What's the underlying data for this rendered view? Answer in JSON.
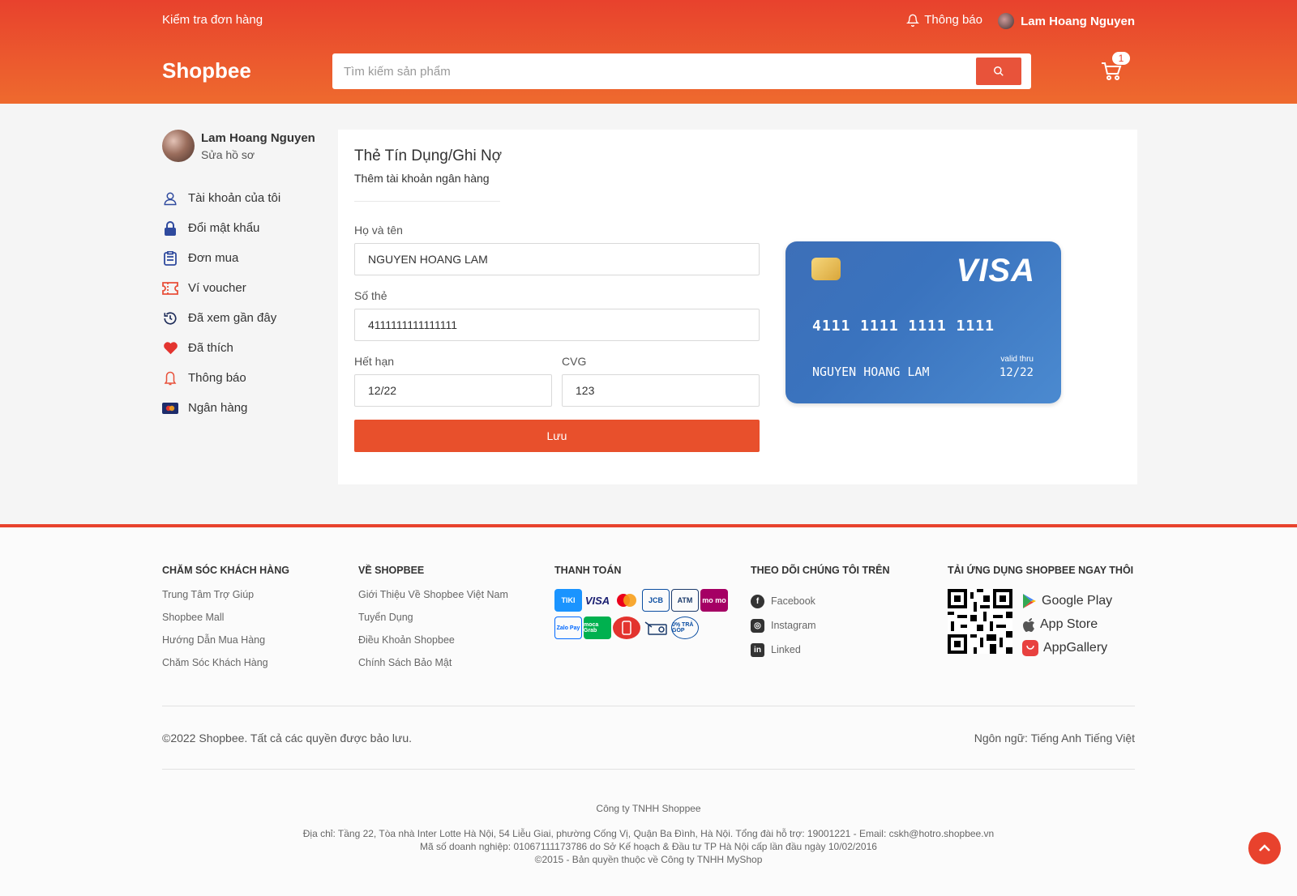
{
  "header": {
    "check_order": "Kiểm tra đơn hàng",
    "notifications": "Thông báo",
    "user_name": "Lam Hoang Nguyen",
    "logo": "Shopbee",
    "search_placeholder": "Tìm kiếm sản phẩm",
    "cart_count": "1"
  },
  "sidebar": {
    "name": "Lam Hoang Nguyen",
    "edit_profile": "Sửa hồ sơ",
    "items": [
      {
        "label": "Tài khoản của tôi",
        "icon": "user-icon"
      },
      {
        "label": "Đổi mật khẩu",
        "icon": "lock-icon"
      },
      {
        "label": "Đơn mua",
        "icon": "clipboard-icon"
      },
      {
        "label": "Ví voucher",
        "icon": "ticket-icon"
      },
      {
        "label": "Đã xem gần đây",
        "icon": "history-icon"
      },
      {
        "label": "Đã thích",
        "icon": "heart-icon"
      },
      {
        "label": "Thông báo",
        "icon": "bell-icon"
      },
      {
        "label": "Ngân hàng",
        "icon": "bank-card-icon"
      }
    ]
  },
  "main": {
    "title": "Thẻ Tín Dụng/Ghi Nợ",
    "subtitle": "Thêm tài khoản ngân hàng",
    "name_label": "Họ và tên",
    "name_value": "NGUYEN HOANG LAM",
    "number_label": "Số thẻ",
    "number_value": "4111111111111111",
    "expiry_label": "Hết hạn",
    "expiry_value": "12/22",
    "cvg_label": "CVG",
    "cvg_value": "123",
    "save_label": "Lưu",
    "card": {
      "brand": "VISA",
      "number": "4111 1111 1111 1111",
      "holder": "NGUYEN HOANG LAM",
      "valid_label": "valid thru",
      "valid_value": "12/22"
    }
  },
  "footer": {
    "customer_care": {
      "heading": "CHĂM SÓC KHÁCH HÀNG",
      "links": [
        "Trung Tâm Trợ Giúp",
        "Shopbee Mall",
        "Hướng Dẫn Mua Hàng",
        "Chăm Sóc Khách Hàng"
      ]
    },
    "about": {
      "heading": "VỀ SHOPBEE",
      "links": [
        "Giới Thiệu Về Shopbee Việt Nam",
        "Tuyển Dụng",
        "Điều Khoản Shopbee",
        "Chính Sách Bảo Mật"
      ]
    },
    "payment": {
      "heading": "THANH TOÁN",
      "methods": [
        "TIKI",
        "VISA",
        "MC",
        "JCB",
        "ATM",
        "mo mo",
        "Zalo Pay",
        "moca Grab",
        "",
        "",
        "0% TRẢ GÓP"
      ]
    },
    "follow": {
      "heading": "THEO DÕI CHÚNG TÔI TRÊN",
      "links": [
        "Facebook",
        "Instagram",
        "Linked"
      ]
    },
    "app": {
      "heading": "TẢI ỨNG DỤNG SHOPBEE NGAY THÔI",
      "stores": [
        "Google Play",
        "App Store",
        "AppGallery"
      ]
    },
    "copyright": "©2022 Shopbee. Tất cả các quyền được bảo lưu.",
    "language": "Ngôn ngữ: Tiếng Anh Tiếng Việt",
    "company_name": "Công ty TNHH Shoppee",
    "address": "Địa chỉ: Tầng 22, Tòa nhà Inter Lotte Hà Nội, 54 Liễu Giai, phường Cống Vị, Quận Ba Đình, Hà Nội. Tổng đài hỗ trợ: 19001221 - Email: cskh@hotro.shopbee.vn",
    "business_no": "Mã số doanh nghiệp: 01067111173786 do Sở Kế hoạch & Đầu tư TP Hà Nội cấp lần đầu ngày 10/02/2016",
    "rights": "©2015 - Bản quyền thuộc về Công ty TNHH MyShop"
  },
  "colors": {
    "brand": "#e8422d",
    "button": "#e8502c",
    "card": "#3a73be"
  }
}
